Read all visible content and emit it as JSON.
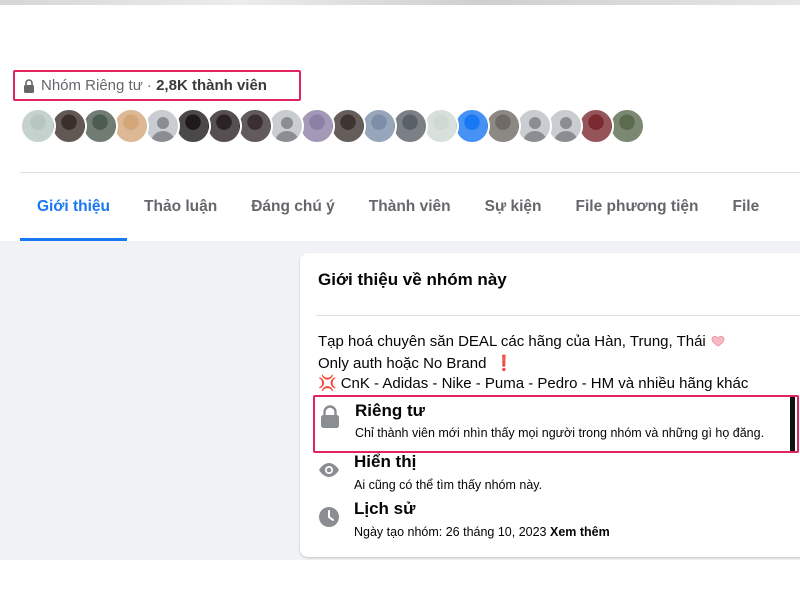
{
  "group": {
    "privacy_label": "Nhóm Riêng tư ·",
    "member_count": "2,8K thành viên"
  },
  "avatars": [
    {
      "name": "member-avatar",
      "bg": "#b7c6c0"
    },
    {
      "name": "member-avatar",
      "bg": "#3a2f2a"
    },
    {
      "name": "member-avatar",
      "bg": "#4d5c50"
    },
    {
      "name": "member-avatar",
      "bg": "#d4a67a"
    },
    {
      "name": "member-avatar-default",
      "bg": "#c9ccd1",
      "default": true
    },
    {
      "name": "member-avatar",
      "bg": "#1e1a1c"
    },
    {
      "name": "member-avatar",
      "bg": "#2b2325"
    },
    {
      "name": "member-avatar",
      "bg": "#3a3034"
    },
    {
      "name": "member-avatar-default",
      "bg": "#c9ccd1",
      "default": true
    },
    {
      "name": "member-avatar",
      "bg": "#8e7fa6"
    },
    {
      "name": "member-avatar",
      "bg": "#3e3530"
    },
    {
      "name": "member-avatar",
      "bg": "#7d8fa8"
    },
    {
      "name": "member-avatar",
      "bg": "#5a6068"
    },
    {
      "name": "member-avatar",
      "bg": "#cfd8d2"
    },
    {
      "name": "member-avatar",
      "bg": "#1877f2"
    },
    {
      "name": "member-avatar",
      "bg": "#6f6a66"
    },
    {
      "name": "member-avatar-default",
      "bg": "#c9ccd1",
      "default": true
    },
    {
      "name": "member-avatar-default",
      "bg": "#c9ccd1",
      "default": true
    },
    {
      "name": "member-avatar",
      "bg": "#7a2a30"
    },
    {
      "name": "member-avatar",
      "bg": "#5a6b4e"
    }
  ],
  "tabs": [
    {
      "label": "Giới thiệu",
      "active": true
    },
    {
      "label": "Thảo luận"
    },
    {
      "label": "Đáng chú ý"
    },
    {
      "label": "Thành viên"
    },
    {
      "label": "Sự kiện"
    },
    {
      "label": "File phương tiện"
    },
    {
      "label": "File"
    }
  ],
  "about": {
    "title": "Giới thiệu về nhóm này",
    "description": [
      "Tạp hoá chuyên săn DEAL các hãng của Hàn, Trung, Thái",
      "Only auth hoặc No Brand",
      "CnK - Adidas - Nike - Puma - Pedro - HM và nhiều hãng khác"
    ],
    "privacy_title": "Riêng tư",
    "privacy_desc": "Chỉ thành viên mới nhìn thấy mọi người trong nhóm và những gì họ đăng.",
    "visibility_title": "Hiển thị",
    "visibility_desc": "Ai cũng có thể tìm thấy nhóm này.",
    "history_title": "Lịch sử",
    "history_desc": "Ngày tạo nhóm: 26 tháng 10, 2023",
    "see_more": "Xem thêm"
  },
  "colors": {
    "accent": "#1877f2",
    "highlight": "#e0245e",
    "icon_gray": "#8a8d91"
  }
}
